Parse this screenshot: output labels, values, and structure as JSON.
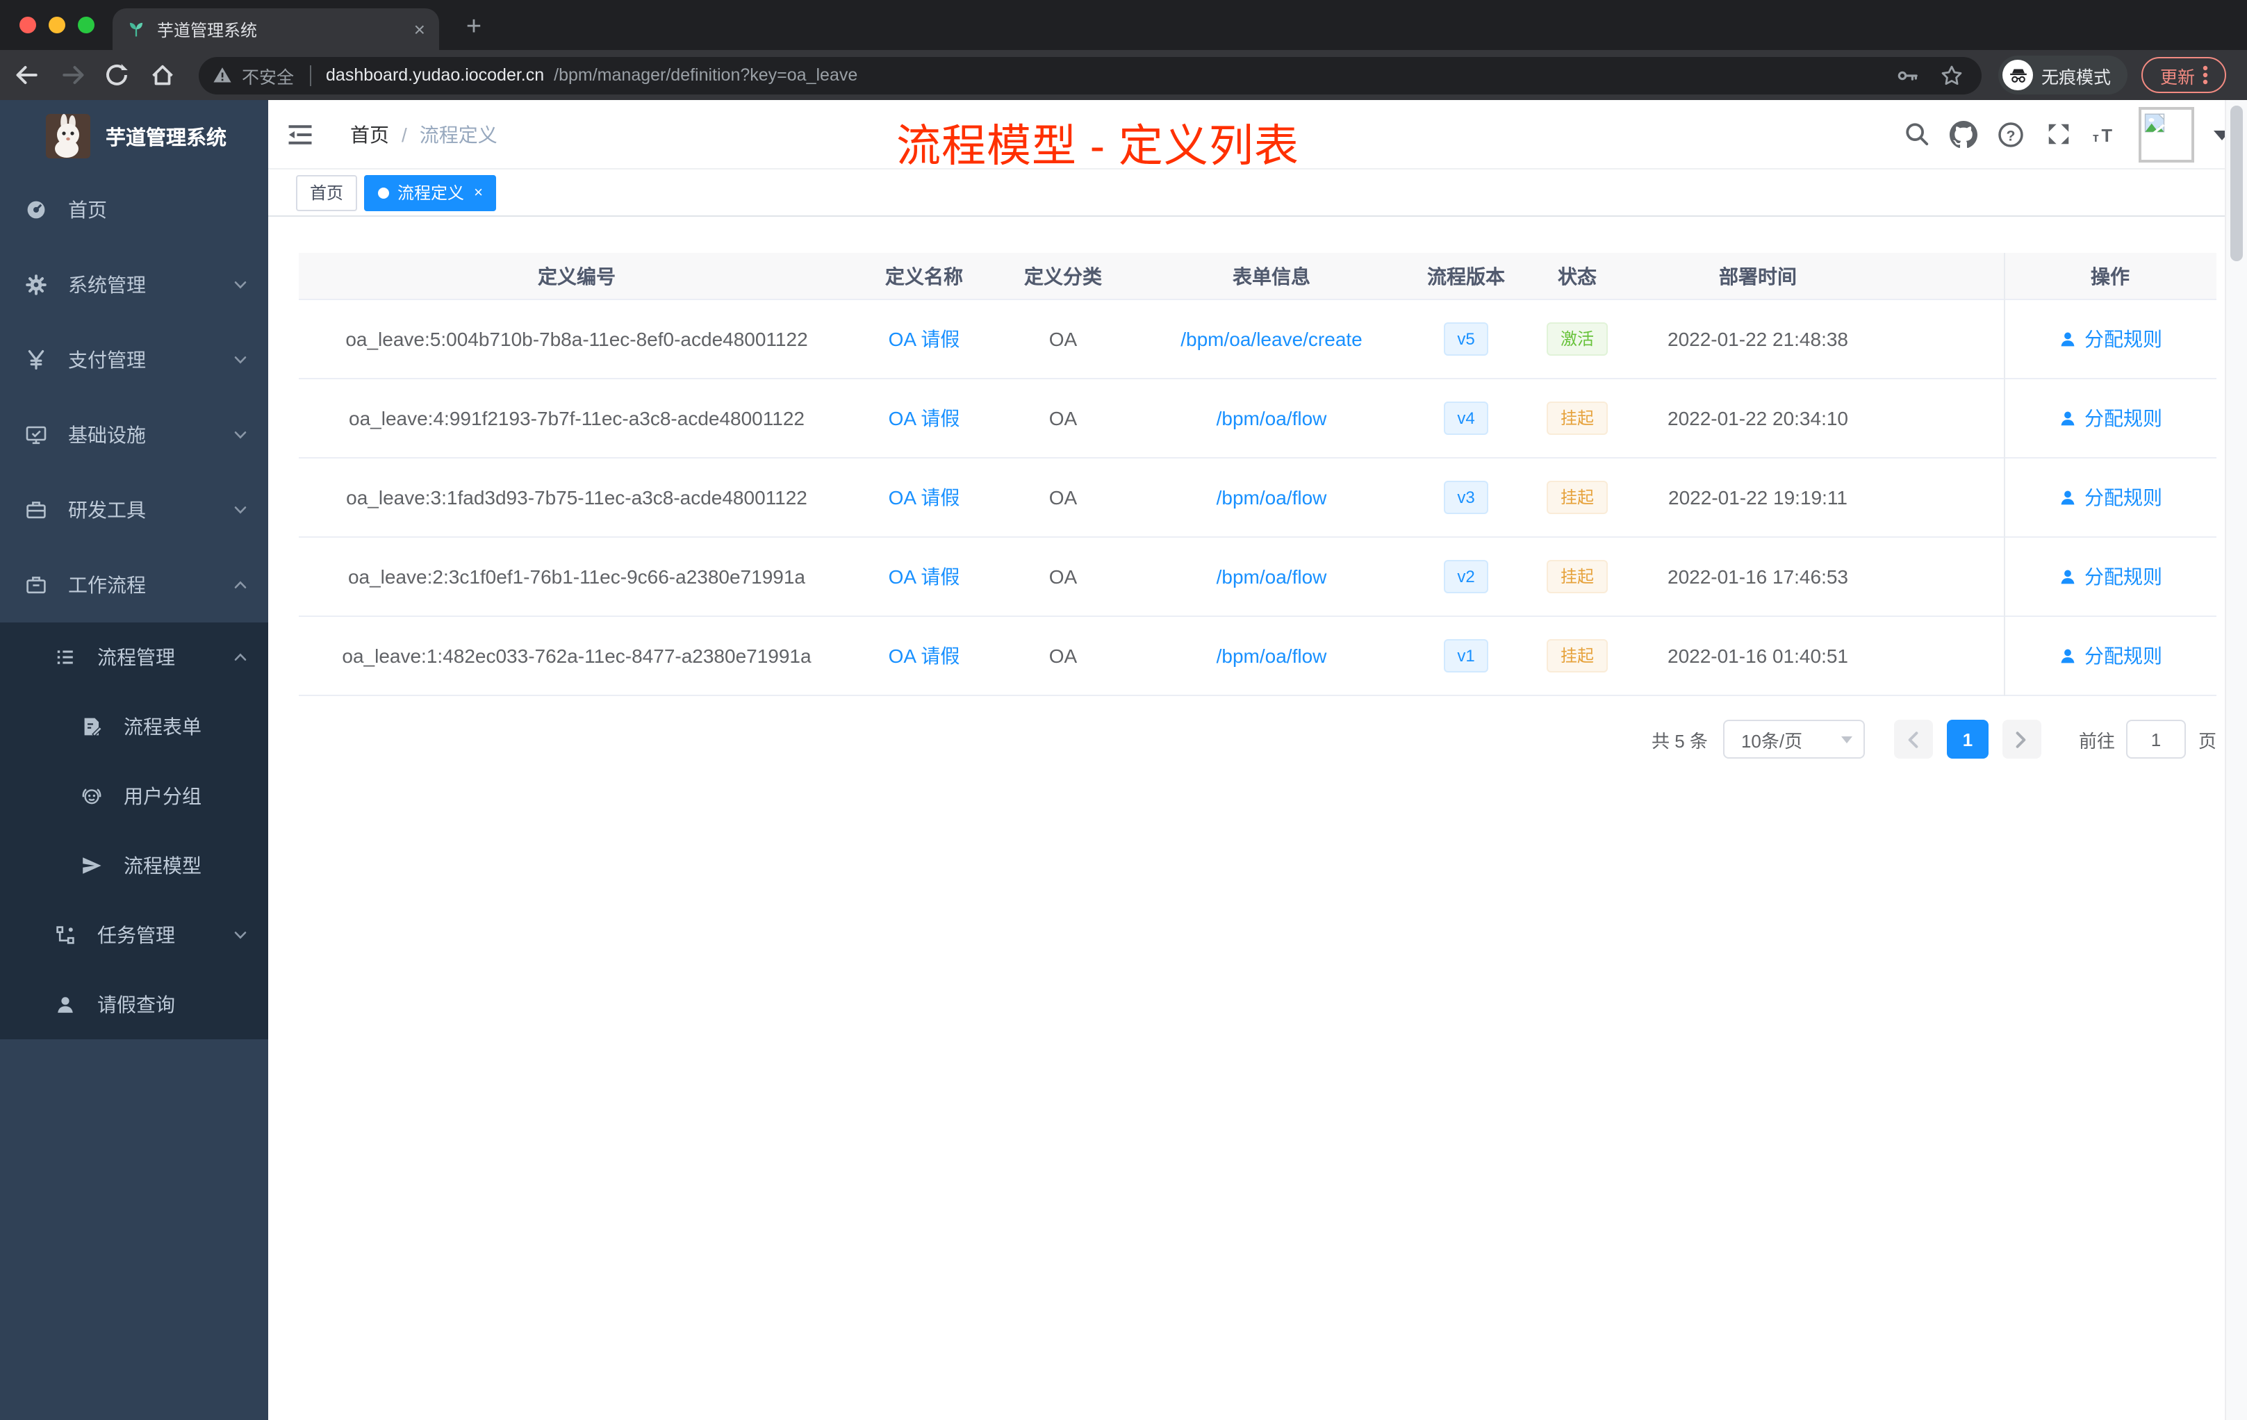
{
  "colors": {
    "accent": "#1890ff",
    "annotation_red": "#ff3000",
    "sidebar_bg": "#304156",
    "submenu_bg": "#1f2d3d",
    "success": "#67c23a",
    "warning": "#e6a23c",
    "tab_active_bg": "#1890ff"
  },
  "browser": {
    "tab_title": "芋道管理系统",
    "not_secure": "不安全",
    "url_host": "dashboard.yudao.iocoder.cn",
    "url_path": "/bpm/manager/definition?key=oa_leave",
    "incognito_label": "无痕模式",
    "update_label": "更新"
  },
  "icons": {
    "tab_close": "×",
    "new_tab": "+",
    "tag_close": "×",
    "breadcrumb_separator": "/"
  },
  "sidebar": {
    "title": "芋道管理系统",
    "items": [
      {
        "label": "首页"
      },
      {
        "label": "系统管理"
      },
      {
        "label": "支付管理"
      },
      {
        "label": "基础设施"
      },
      {
        "label": "研发工具"
      },
      {
        "label": "工作流程"
      },
      {
        "label": "流程管理"
      },
      {
        "label": "流程表单"
      },
      {
        "label": "用户分组"
      },
      {
        "label": "流程模型"
      },
      {
        "label": "任务管理"
      },
      {
        "label": "请假查询"
      }
    ]
  },
  "navbar": {
    "breadcrumb": [
      "首页",
      "流程定义"
    ],
    "annotation": "流程模型 - 定义列表"
  },
  "tags": [
    {
      "label": "首页"
    },
    {
      "label": "流程定义"
    }
  ],
  "table": {
    "columns": [
      "定义编号",
      "定义名称",
      "定义分类",
      "表单信息",
      "流程版本",
      "状态",
      "部署时间",
      "操作"
    ],
    "rows": [
      {
        "id": "oa_leave:5:004b710b-7b8a-11ec-8ef0-acde48001122",
        "name": "OA 请假",
        "category": "OA",
        "form": "/bpm/oa/leave/create",
        "version": "v5",
        "status": "激活",
        "time": "2022-01-22 21:48:38",
        "action": "分配规则"
      },
      {
        "id": "oa_leave:4:991f2193-7b7f-11ec-a3c8-acde48001122",
        "name": "OA 请假",
        "category": "OA",
        "form": "/bpm/oa/flow",
        "version": "v4",
        "status": "挂起",
        "time": "2022-01-22 20:34:10",
        "action": "分配规则"
      },
      {
        "id": "oa_leave:3:1fad3d93-7b75-11ec-a3c8-acde48001122",
        "name": "OA 请假",
        "category": "OA",
        "form": "/bpm/oa/flow",
        "version": "v3",
        "status": "挂起",
        "time": "2022-01-22 19:19:11",
        "action": "分配规则"
      },
      {
        "id": "oa_leave:2:3c1f0ef1-76b1-11ec-9c66-a2380e71991a",
        "name": "OA 请假",
        "category": "OA",
        "form": "/bpm/oa/flow",
        "version": "v2",
        "status": "挂起",
        "time": "2022-01-16 17:46:53",
        "action": "分配规则"
      },
      {
        "id": "oa_leave:1:482ec033-762a-11ec-8477-a2380e71991a",
        "name": "OA 请假",
        "category": "OA",
        "form": "/bpm/oa/flow",
        "version": "v1",
        "status": "挂起",
        "time": "2022-01-16 01:40:51",
        "action": "分配规则"
      }
    ]
  },
  "pagination": {
    "total": "共 5 条",
    "page_size": "10条/页",
    "current_page": "1",
    "goto_label": "前往",
    "goto_value": "1",
    "page_unit": "页"
  }
}
